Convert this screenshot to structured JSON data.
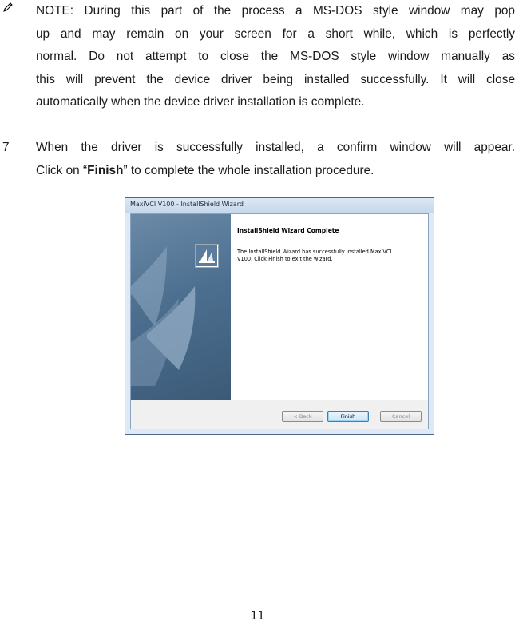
{
  "note": {
    "lines": [
      "NOTE: During this part of the process a MS-DOS style window may pop",
      "up and may remain on your screen for a short while, which is perfectly",
      "normal. Do not attempt to close the MS-DOS style window manually as",
      "this will prevent the device driver being installed successfully. It will close",
      "automatically when the device driver installation is complete."
    ]
  },
  "step": {
    "number": "7",
    "line1": "When the driver is successfully installed, a confirm window will appear.",
    "line2_prefix": "Click on “",
    "line2_bold": "Finish",
    "line2_suffix": "” to complete the whole installation procedure."
  },
  "window": {
    "title": "MaxiVCI V100 - InstallShield Wizard",
    "heading": "InstallShield Wizard Complete",
    "body_line1": "The InstallShield Wizard has successfully installed MaxiVCI",
    "body_line2": "V100.  Click Finish to exit the wizard.",
    "buttons": {
      "back": "< Back",
      "finish": "Finish",
      "cancel": "Cancel"
    }
  },
  "page_number": "11"
}
